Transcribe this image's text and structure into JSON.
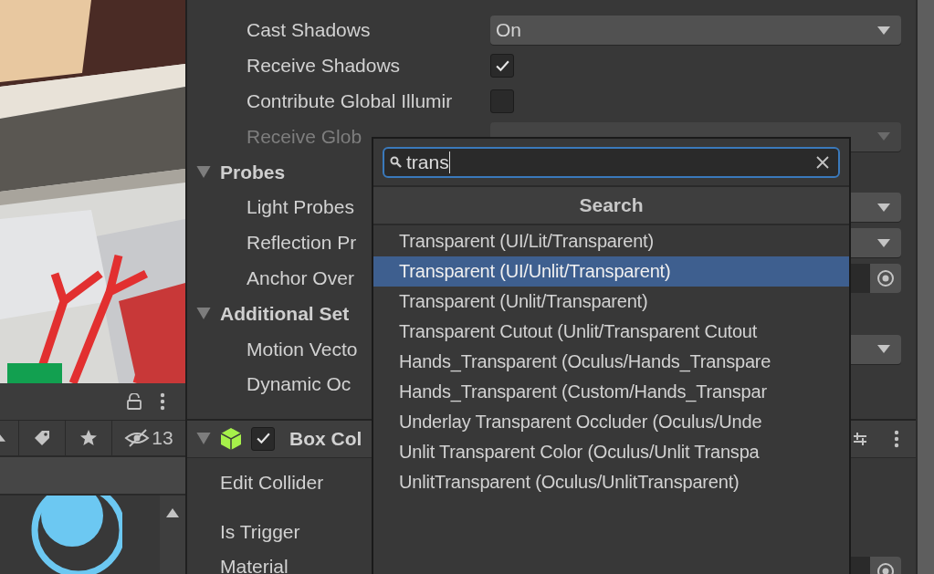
{
  "project_panel": {
    "toolbar": [
      {
        "kind": "label-filter"
      },
      {
        "kind": "star-filter"
      },
      {
        "kind": "hidden-count",
        "count": "13"
      }
    ]
  },
  "inspector": {
    "rows": [
      {
        "kind": "dropdown",
        "label": "Cast Shadows",
        "value": "On",
        "disabled": false
      },
      {
        "kind": "checkbox",
        "label": "Receive Shadows",
        "checked": true
      },
      {
        "kind": "checkbox",
        "label": "Contribute Global Illumir",
        "checked": false
      },
      {
        "kind": "dropdown",
        "label": "Receive Glob",
        "disabled": true
      },
      {
        "kind": "header",
        "label": "Probes",
        "expanded": true
      },
      {
        "kind": "dropdown",
        "label": "Light Probes",
        "disabled": false
      },
      {
        "kind": "dropdown",
        "label": "Reflection Pr",
        "disabled": false
      },
      {
        "kind": "object",
        "label": "Anchor Over"
      },
      {
        "kind": "header",
        "label": "Additional Set",
        "expanded": true
      },
      {
        "kind": "dropdown",
        "label": "Motion Vecto",
        "disabled": false
      },
      {
        "kind": "label",
        "label": "Dynamic Oc"
      },
      {
        "kind": "component",
        "label": "Box Col",
        "expanded": true,
        "enabled": true
      },
      {
        "kind": "field",
        "label": "Edit Collider"
      },
      {
        "kind": "field",
        "label": "Is Trigger"
      },
      {
        "kind": "object",
        "label": "Material"
      }
    ]
  },
  "popup": {
    "search": {
      "value": "trans"
    },
    "header": "Search",
    "items": [
      {
        "label": "Transparent (UI/Lit/Transparent)",
        "selected": false
      },
      {
        "label": "Transparent (UI/Unlit/Transparent)",
        "selected": true
      },
      {
        "label": "Transparent (Unlit/Transparent)",
        "selected": false
      },
      {
        "label": "Transparent Cutout (Unlit/Transparent Cutout",
        "selected": false
      },
      {
        "label": "Hands_Transparent (Oculus/Hands_Transpare",
        "selected": false
      },
      {
        "label": "Hands_Transparent (Custom/Hands_Transpar",
        "selected": false
      },
      {
        "label": "Underlay Transparent Occluder (Oculus/Unde",
        "selected": false
      },
      {
        "label": "Unlit Transparent Color (Oculus/Unlit Transpa",
        "selected": false
      },
      {
        "label": "UnlitTransparent (Oculus/UnlitTransparent)",
        "selected": false
      }
    ]
  }
}
